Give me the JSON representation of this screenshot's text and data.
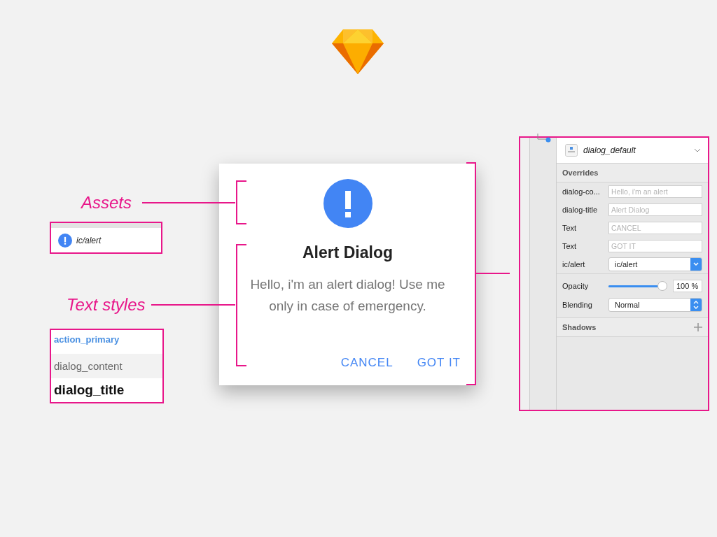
{
  "annotations": [
    {
      "label": "Assets"
    },
    {
      "label": "Text styles"
    }
  ],
  "assets": [
    {
      "name": "ic/alert"
    }
  ],
  "text_styles": [
    {
      "name": "action_primary",
      "kind": "action"
    },
    {
      "name": "dialog_content",
      "kind": "content"
    },
    {
      "name": "dialog_title",
      "kind": "title"
    }
  ],
  "dialog": {
    "title": "Alert Dialog",
    "content": "Hello, i'm an alert dialog! Use me only in case of emergency.",
    "actions": [
      "CANCEL",
      "GOT IT"
    ]
  },
  "inspector": {
    "symbol": "dialog_default",
    "overrides_header": "Overrides",
    "overrides": [
      {
        "label": "dialog-co...",
        "kind": "text",
        "placeholder": "Hello, i'm an alert"
      },
      {
        "label": "dialog-title",
        "kind": "text",
        "placeholder": "Alert Dialog"
      },
      {
        "label": "Text",
        "kind": "text",
        "placeholder": "CANCEL"
      },
      {
        "label": "Text",
        "kind": "text",
        "placeholder": "GOT IT"
      },
      {
        "label": "ic/alert",
        "kind": "select",
        "value": "ic/alert"
      }
    ],
    "opacity": {
      "label": "Opacity",
      "level": 1,
      "value": "100 %"
    },
    "blending": {
      "label": "Blending",
      "value": "Normal"
    },
    "shadows_header": "Shadows"
  }
}
